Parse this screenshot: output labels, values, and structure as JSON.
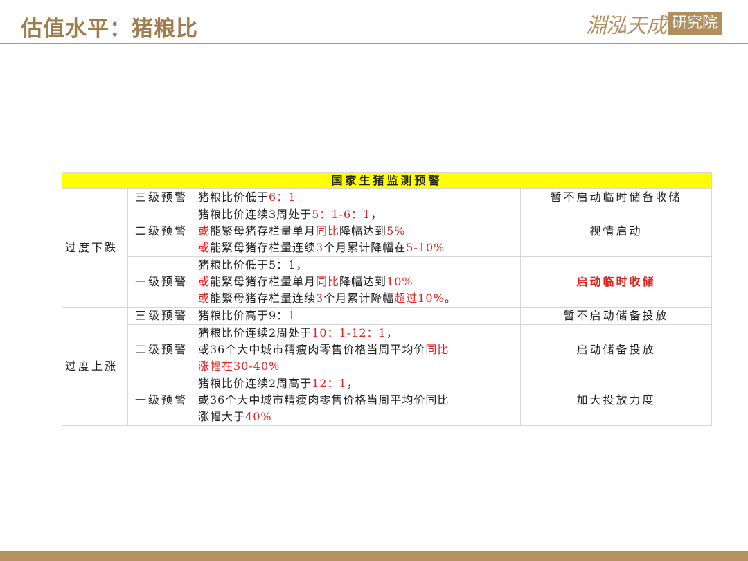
{
  "header": {
    "title": "估值水平：猪粮比",
    "logo_script": "淵泓天成",
    "logo_seal": "研究院"
  },
  "table": {
    "title": "国家生猪监测预警",
    "groups": [
      {
        "category": "过度下跌",
        "rows": [
          {
            "level": "三级预警",
            "lines": [
              [
                {
                  "t": "猪粮比价低于"
                },
                {
                  "t": "6：1",
                  "red": true
                }
              ]
            ],
            "action": "暂不启动临时储备收储",
            "action_red": false
          },
          {
            "level": "二级预警",
            "lines": [
              [
                {
                  "t": "猪粮比价连续3周处于"
                },
                {
                  "t": "5：1-6：1",
                  "red": true
                },
                {
                  "t": "，"
                }
              ],
              [
                {
                  "t": "或",
                  "red": true
                },
                {
                  "t": "能繁母猪存栏量单月"
                },
                {
                  "t": "同比",
                  "red": true
                },
                {
                  "t": "降幅达到"
                },
                {
                  "t": "5%",
                  "red": true
                }
              ],
              [
                {
                  "t": "或",
                  "red": true
                },
                {
                  "t": "能繁母猪存栏量连续"
                },
                {
                  "t": "3",
                  "red": true
                },
                {
                  "t": "个月累计降幅在"
                },
                {
                  "t": "5-10%",
                  "red": true
                }
              ]
            ],
            "action": "视情启动",
            "action_red": false
          },
          {
            "level": "一级预警",
            "lines": [
              [
                {
                  "t": "猪粮比价低于5：1，"
                }
              ],
              [
                {
                  "t": "或",
                  "red": true
                },
                {
                  "t": "能繁母猪存栏量单月"
                },
                {
                  "t": "同比",
                  "red": true
                },
                {
                  "t": "降幅达到"
                },
                {
                  "t": "10%",
                  "red": true
                }
              ],
              [
                {
                  "t": "或",
                  "red": true
                },
                {
                  "t": "能繁母猪存栏量连续"
                },
                {
                  "t": "3",
                  "red": true
                },
                {
                  "t": "个月累计降幅"
                },
                {
                  "t": "超过10%",
                  "red": true
                },
                {
                  "t": "。"
                }
              ]
            ],
            "action": "启动临时收储",
            "action_red": true
          }
        ]
      },
      {
        "category": "过度上涨",
        "rows": [
          {
            "level": "三级预警",
            "lines": [
              [
                {
                  "t": "猪粮比价高于9：1"
                }
              ]
            ],
            "action": "暂不启动储备投放",
            "action_red": false
          },
          {
            "level": "二级预警",
            "lines": [
              [
                {
                  "t": "猪粮比价连续2周处于"
                },
                {
                  "t": "10：1-12：1",
                  "red": true
                },
                {
                  "t": "，"
                }
              ],
              [
                {
                  "t": "或36个大中城市精瘦肉零售价格当周平均价"
                },
                {
                  "t": "同比",
                  "red": true
                }
              ],
              [
                {
                  "t": "涨幅在30-40%",
                  "red": true
                }
              ]
            ],
            "action": "启动储备投放",
            "action_red": false
          },
          {
            "level": "一级预警",
            "lines": [
              [
                {
                  "t": "猪粮比价连续2周高于"
                },
                {
                  "t": "12：1",
                  "red": true
                },
                {
                  "t": "，"
                }
              ],
              [
                {
                  "t": "或36个大中城市精瘦肉零售价格当周平均价同比"
                }
              ],
              [
                {
                  "t": "涨幅大于"
                },
                {
                  "t": "40%",
                  "red": true
                }
              ]
            ],
            "action": "加大投放力度",
            "action_red": false
          }
        ]
      }
    ]
  }
}
